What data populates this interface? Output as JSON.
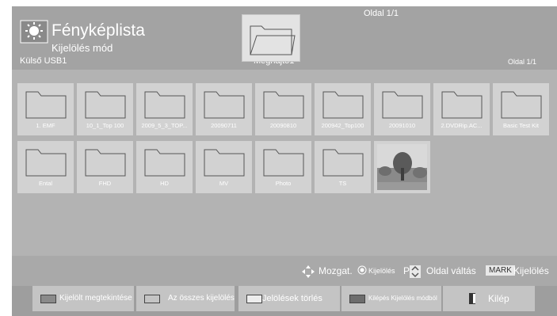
{
  "header": {
    "title": "Fényképlista",
    "subtitle": "Kijelölés mód",
    "source": "Külső USB1",
    "drive": "Meghajtó1",
    "page_top": "Oldal 1/1",
    "page_right": "Oldal 1/1"
  },
  "items": [
    {
      "label": "1. EMF",
      "type": "folder"
    },
    {
      "label": "10_1_Top 100",
      "type": "folder"
    },
    {
      "label": "2009_5_3_TOP...",
      "type": "folder"
    },
    {
      "label": "20090711",
      "type": "folder"
    },
    {
      "label": "20090810",
      "type": "folder"
    },
    {
      "label": "200942_Top100",
      "type": "folder"
    },
    {
      "label": "20091010",
      "type": "folder"
    },
    {
      "label": "2.DVDRip.AC...",
      "type": "folder"
    },
    {
      "label": "Basic Test Kit",
      "type": "folder"
    },
    {
      "label": "Ental",
      "type": "folder"
    },
    {
      "label": "FHD",
      "type": "folder"
    },
    {
      "label": "HD",
      "type": "folder"
    },
    {
      "label": "MV",
      "type": "folder"
    },
    {
      "label": "Photo",
      "type": "folder"
    },
    {
      "label": "TS",
      "type": "folder"
    },
    {
      "label": "",
      "type": "photo"
    }
  ],
  "status_bar": {
    "move_label": "Mozgat.",
    "select_label": "Kijelölés",
    "page_key": "P",
    "page_label": "Oldal váltás",
    "mark_key": "MARK",
    "mark_label": "Kijelölés"
  },
  "buttons": {
    "view_selected": "Kijelölt megtekintése",
    "select_all": "Az összes kijelölése",
    "clear_marks": "Jelölések törlés",
    "exit_mark_mode": "Kilépés Kijelölés módból",
    "exit": "Kilép"
  },
  "colors": {
    "background": "#a9a9a9",
    "tile": "#d2d2d2",
    "text": "#ffffff"
  }
}
